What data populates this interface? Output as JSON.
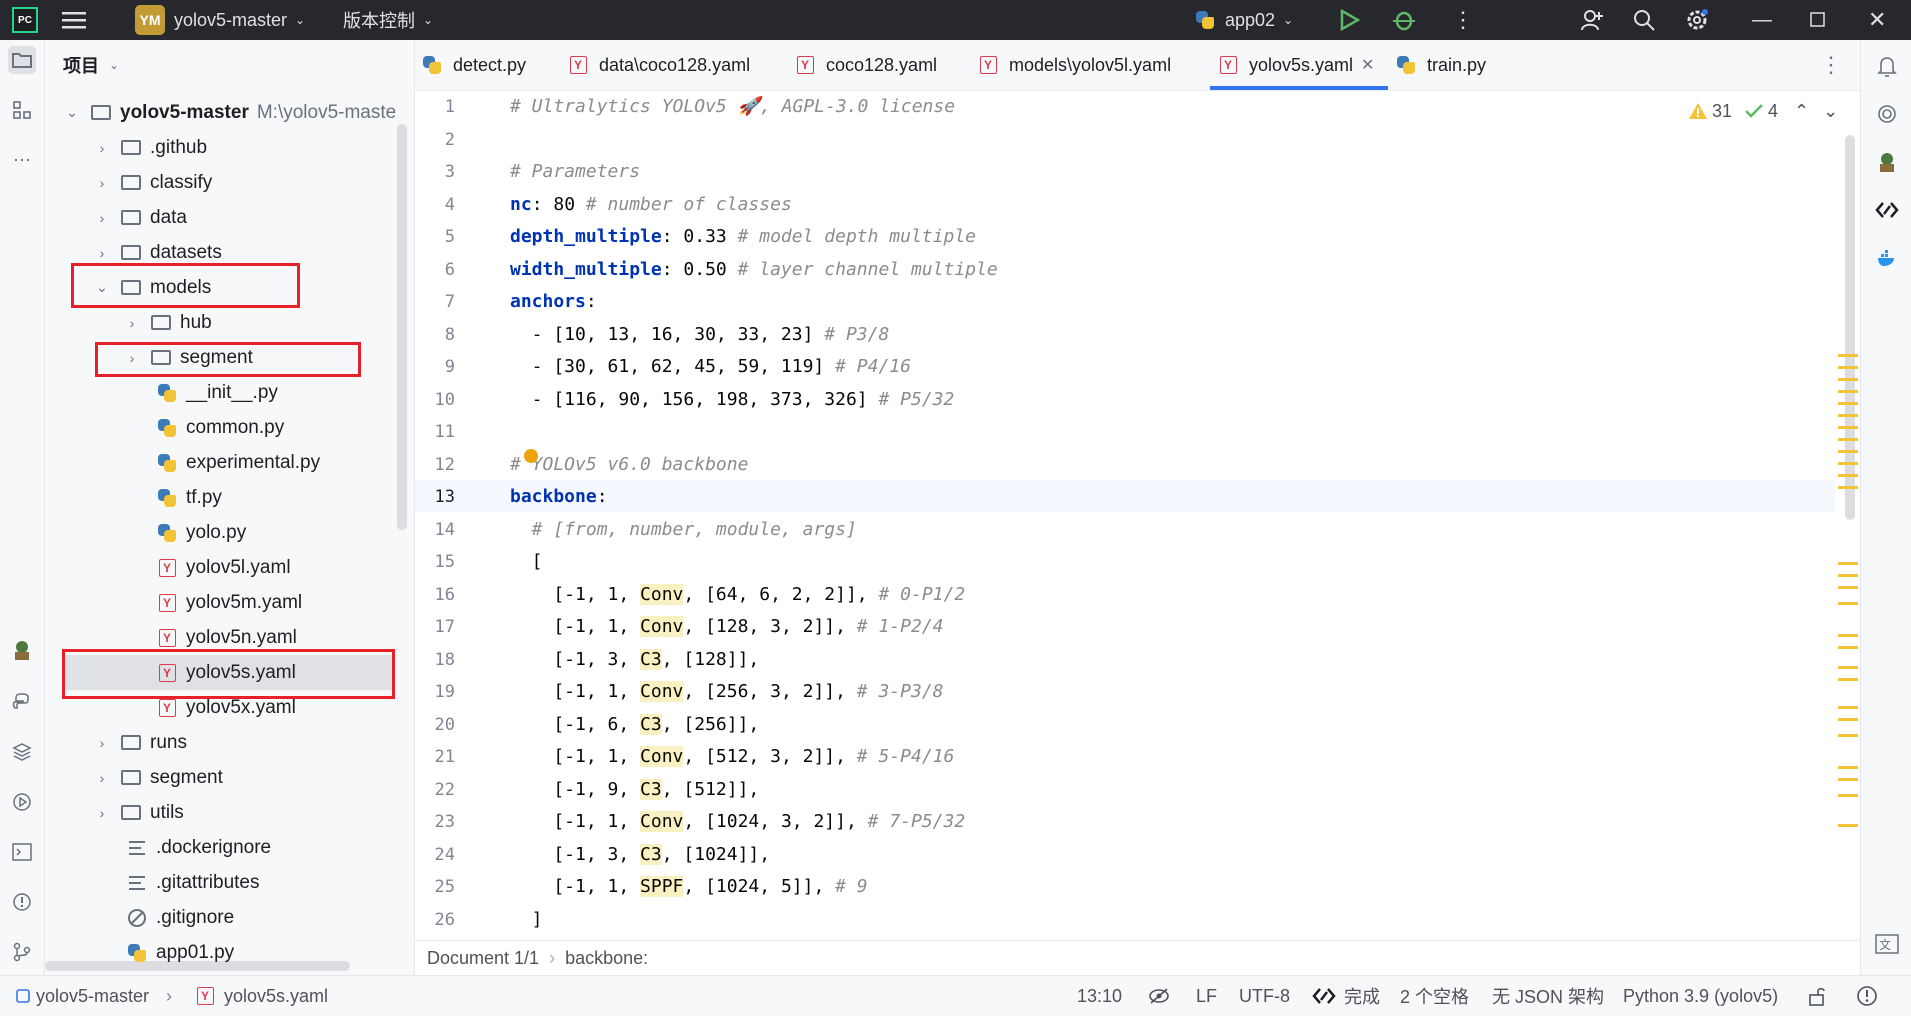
{
  "titlebar": {
    "logo": "PC",
    "menu_icon": "hamburger-menu-icon",
    "project_badge": "YM",
    "project_name": "yolov5-master",
    "vcs_label": "版本控制",
    "run_config": "app02"
  },
  "project_panel": {
    "title": "项目",
    "root_name": "yolov5-master",
    "root_path": "M:\\yolov5-maste",
    "items": [
      {
        "label": ".github"
      },
      {
        "label": "classify"
      },
      {
        "label": "data"
      },
      {
        "label": "datasets"
      },
      {
        "label": "models"
      },
      {
        "label": "hub"
      },
      {
        "label": "segment"
      },
      {
        "label": "__init__.py"
      },
      {
        "label": "common.py"
      },
      {
        "label": "experimental.py"
      },
      {
        "label": "tf.py"
      },
      {
        "label": "yolo.py"
      },
      {
        "label": "yolov5l.yaml"
      },
      {
        "label": "yolov5m.yaml"
      },
      {
        "label": "yolov5n.yaml"
      },
      {
        "label": "yolov5s.yaml"
      },
      {
        "label": "yolov5x.yaml"
      },
      {
        "label": "runs"
      },
      {
        "label": "segment"
      },
      {
        "label": "utils"
      },
      {
        "label": ".dockerignore"
      },
      {
        "label": ".gitattributes"
      },
      {
        "label": ".gitignore"
      },
      {
        "label": "app01.py"
      }
    ]
  },
  "tabs": [
    {
      "label": "detect.py"
    },
    {
      "label": "data\\coco128.yaml"
    },
    {
      "label": "coco128.yaml"
    },
    {
      "label": "models\\yolov5l.yaml"
    },
    {
      "label": "yolov5s.yaml"
    },
    {
      "label": "train.py"
    }
  ],
  "inspections": {
    "warnings": "31",
    "checks": "4"
  },
  "editor": {
    "line_numbers": [
      "1",
      "2",
      "3",
      "4",
      "5",
      "6",
      "7",
      "8",
      "9",
      "10",
      "11",
      "12",
      "13",
      "14",
      "15",
      "16",
      "17",
      "18",
      "19",
      "20",
      "21",
      "22",
      "23",
      "24",
      "25",
      "26"
    ],
    "l1": "# Ultralytics YOLOv5 🚀, AGPL-3.0 license",
    "l3": "# Parameters",
    "l4k": "nc",
    "l4v": ": 80 ",
    "l4c": "# number of classes",
    "l5k": "depth_multiple",
    "l5v": ": 0.33 ",
    "l5c": "# model depth multiple",
    "l6k": "width_multiple",
    "l6v": ": 0.50 ",
    "l6c": "# layer channel multiple",
    "l7k": "anchors",
    "l7v": ":",
    "l8v": "  - [10, 13, 16, 30, 33, 23] ",
    "l8c": "# P3/8",
    "l9v": "  - [30, 61, 62, 45, 59, 119] ",
    "l9c": "# P4/16",
    "l10v": "  - [116, 90, 156, 198, 373, 326] ",
    "l10c": "# P5/32",
    "l12": "# YOLOv5 v6.0 backbone",
    "l13k": "backbone",
    "l13v": ":",
    "l14": "  # [from, number, module, args]",
    "l15": "  [",
    "l16a": "    [-1, 1, ",
    "l16m": "Conv",
    "l16b": ", [64, 6, 2, 2]], ",
    "l16c": "# 0-P1/2",
    "l17a": "    [-1, 1, ",
    "l17m": "Conv",
    "l17b": ", [128, 3, 2]], ",
    "l17c": "# 1-P2/4",
    "l18a": "    [-1, 3, ",
    "l18m": "C3",
    "l18b": ", [128]],",
    "l19a": "    [-1, 1, ",
    "l19m": "Conv",
    "l19b": ", [256, 3, 2]], ",
    "l19c": "# 3-P3/8",
    "l20a": "    [-1, 6, ",
    "l20m": "C3",
    "l20b": ", [256]],",
    "l21a": "    [-1, 1, ",
    "l21m": "Conv",
    "l21b": ", [512, 3, 2]], ",
    "l21c": "# 5-P4/16",
    "l22a": "    [-1, 9, ",
    "l22m": "C3",
    "l22b": ", [512]],",
    "l23a": "    [-1, 1, ",
    "l23m": "Conv",
    "l23b": ", [1024, 3, 2]], ",
    "l23c": "# 7-P5/32",
    "l24a": "    [-1, 3, ",
    "l24m": "C3",
    "l24b": ", [1024]],",
    "l25a": "    [-1, 1, ",
    "l25m": "SPPF",
    "l25b": ", [1024, 5]], ",
    "l25c": "# 9",
    "l26": "  ]"
  },
  "breadcrumb": {
    "document": "Document 1/1",
    "path": "backbone:"
  },
  "statusbar": {
    "project": "yolov5-master",
    "file": "yolov5s.yaml",
    "position": "13:10",
    "line_sep": "LF",
    "encoding": "UTF-8",
    "done": "完成",
    "indent": "2 个空格",
    "schema": "无 JSON 架构",
    "interpreter": "Python 3.9 (yolov5)"
  },
  "colors": {
    "accent": "#3574f0",
    "highlight_box": "#e8202a",
    "conv_highlight": "#faf1c2"
  }
}
